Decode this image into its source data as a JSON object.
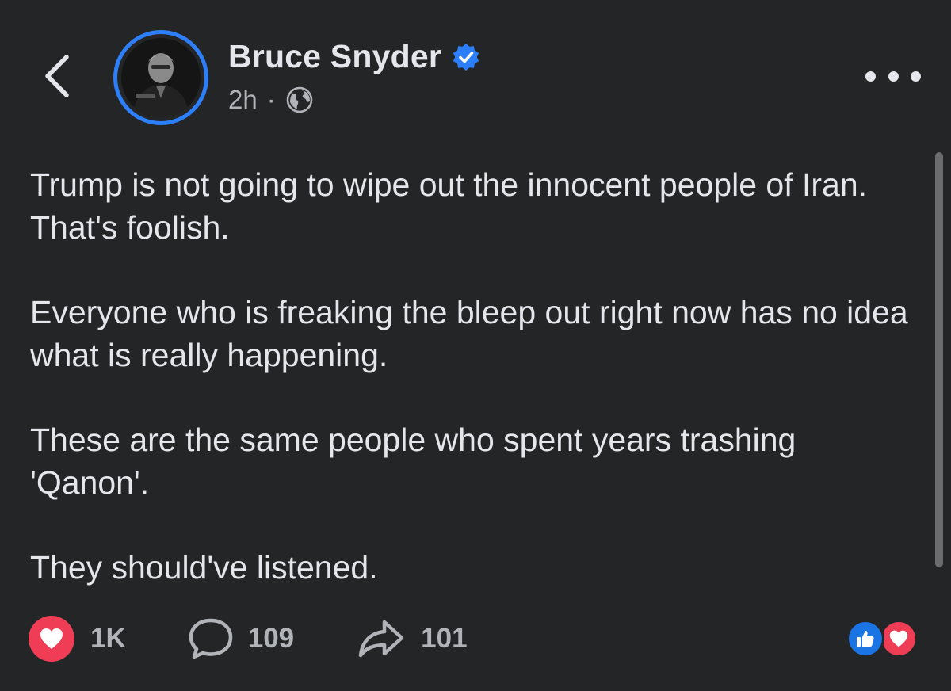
{
  "header": {
    "author_name": "Bruce Snyder",
    "verified": true,
    "timestamp": "2h",
    "separator": "·",
    "audience_icon": "globe-icon",
    "back_icon": "chevron-left-icon",
    "more_icon": "more-horizontal-icon"
  },
  "post": {
    "paragraphs": [
      "Trump is not going to wipe out the innocent people of Iran. That's foolish.",
      "Everyone who is freaking the bleep out right now has no idea what is really happening.",
      "These are the same people who spent years trashing 'Qanon'.",
      "They should've listened."
    ]
  },
  "actions": {
    "reaction": {
      "icon": "heart-icon",
      "count": "1K"
    },
    "comment": {
      "icon": "comment-icon",
      "count": "109"
    },
    "share": {
      "icon": "share-icon",
      "count": "101"
    }
  },
  "reactions_summary": [
    "like-icon",
    "love-icon"
  ],
  "colors": {
    "background": "#242526",
    "text_primary": "#e4e6eb",
    "text_secondary": "#b0b3b8",
    "accent_blue": "#2d7ff9",
    "love_red": "#ee3d55"
  }
}
